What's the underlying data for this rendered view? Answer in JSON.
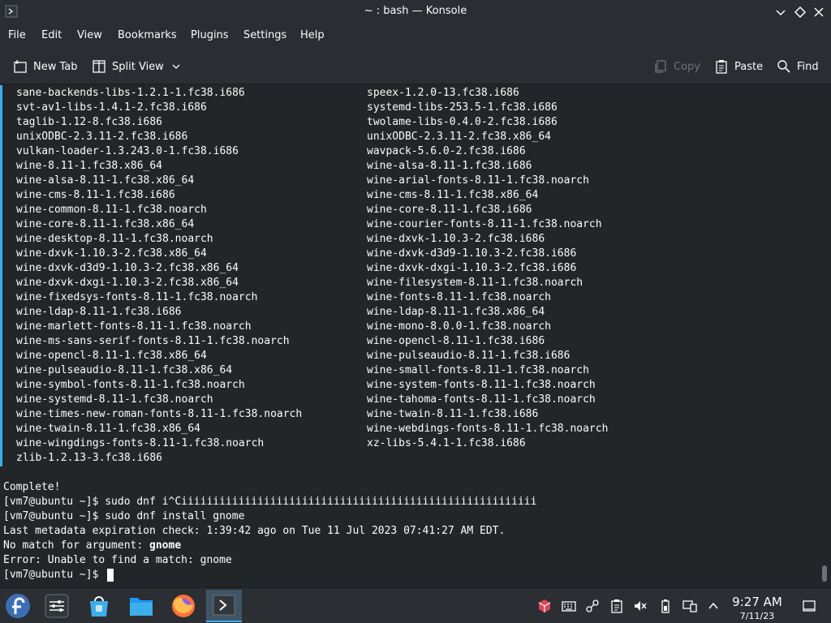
{
  "window": {
    "title": "~ : bash — Konsole"
  },
  "menu": [
    "File",
    "Edit",
    "View",
    "Bookmarks",
    "Plugins",
    "Settings",
    "Help"
  ],
  "toolbar": {
    "new_tab": "New Tab",
    "split_view": "Split View",
    "copy": "Copy",
    "paste": "Paste",
    "find": "Find"
  },
  "terminal": {
    "columns": [
      [
        "sane-backends-libs-1.2.1-1.fc38.i686",
        "speex-1.2.0-13.fc38.i686"
      ],
      [
        "svt-av1-libs-1.4.1-2.fc38.i686",
        "systemd-libs-253.5-1.fc38.i686"
      ],
      [
        "taglib-1.12-8.fc38.i686",
        "twolame-libs-0.4.0-2.fc38.i686"
      ],
      [
        "unixODBC-2.3.11-2.fc38.i686",
        "unixODBC-2.3.11-2.fc38.x86_64"
      ],
      [
        "vulkan-loader-1.3.243.0-1.fc38.i686",
        "wavpack-5.6.0-2.fc38.i686"
      ],
      [
        "wine-8.11-1.fc38.x86_64",
        "wine-alsa-8.11-1.fc38.i686"
      ],
      [
        "wine-alsa-8.11-1.fc38.x86_64",
        "wine-arial-fonts-8.11-1.fc38.noarch"
      ],
      [
        "wine-cms-8.11-1.fc38.i686",
        "wine-cms-8.11-1.fc38.x86_64"
      ],
      [
        "wine-common-8.11-1.fc38.noarch",
        "wine-core-8.11-1.fc38.i686"
      ],
      [
        "wine-core-8.11-1.fc38.x86_64",
        "wine-courier-fonts-8.11-1.fc38.noarch"
      ],
      [
        "wine-desktop-8.11-1.fc38.noarch",
        "wine-dxvk-1.10.3-2.fc38.i686"
      ],
      [
        "wine-dxvk-1.10.3-2.fc38.x86_64",
        "wine-dxvk-d3d9-1.10.3-2.fc38.i686"
      ],
      [
        "wine-dxvk-d3d9-1.10.3-2.fc38.x86_64",
        "wine-dxvk-dxgi-1.10.3-2.fc38.i686"
      ],
      [
        "wine-dxvk-dxgi-1.10.3-2.fc38.x86_64",
        "wine-filesystem-8.11-1.fc38.noarch"
      ],
      [
        "wine-fixedsys-fonts-8.11-1.fc38.noarch",
        "wine-fonts-8.11-1.fc38.noarch"
      ],
      [
        "wine-ldap-8.11-1.fc38.i686",
        "wine-ldap-8.11-1.fc38.x86_64"
      ],
      [
        "wine-marlett-fonts-8.11-1.fc38.noarch",
        "wine-mono-8.0.0-1.fc38.noarch"
      ],
      [
        "wine-ms-sans-serif-fonts-8.11-1.fc38.noarch",
        "wine-opencl-8.11-1.fc38.i686"
      ],
      [
        "wine-opencl-8.11-1.fc38.x86_64",
        "wine-pulseaudio-8.11-1.fc38.i686"
      ],
      [
        "wine-pulseaudio-8.11-1.fc38.x86_64",
        "wine-small-fonts-8.11-1.fc38.noarch"
      ],
      [
        "wine-symbol-fonts-8.11-1.fc38.noarch",
        "wine-system-fonts-8.11-1.fc38.noarch"
      ],
      [
        "wine-systemd-8.11-1.fc38.noarch",
        "wine-tahoma-fonts-8.11-1.fc38.noarch"
      ],
      [
        "wine-times-new-roman-fonts-8.11-1.fc38.noarch",
        "wine-twain-8.11-1.fc38.i686"
      ],
      [
        "wine-twain-8.11-1.fc38.x86_64",
        "wine-webdings-fonts-8.11-1.fc38.noarch"
      ],
      [
        "wine-wingdings-fonts-8.11-1.fc38.noarch",
        "xz-libs-5.4.1-1.fc38.i686"
      ],
      [
        "zlib-1.2.13-3.fc38.i686",
        ""
      ]
    ],
    "complete": "Complete!",
    "cmd1": "[vm7@ubuntu ~]$ sudo dnf i^Ciiiiiiiiiiiiiiiiiiiiiiiiiiiiiiiiiiiiiiiiiiiiiiiiiiiiiiii",
    "cmd2": "[vm7@ubuntu ~]$ sudo dnf install gnome",
    "metadata": "Last metadata expiration check: 1:39:42 ago on Tue 11 Jul 2023 07:41:27 AM EDT.",
    "nomatch_prefix": "No match for argument: ",
    "nomatch_arg": "gnome",
    "error": "Error: Unable to find a match: gnome",
    "prompt": "[vm7@ubuntu ~]$ "
  },
  "taskbar": {
    "apps": [
      "fedora-launcher-icon",
      "system-settings-icon",
      "discover-store-icon",
      "file-manager-icon",
      "firefox-icon",
      "konsole-icon"
    ],
    "time": "9:27 AM",
    "date": "7/11/23"
  },
  "colors": {
    "accent": "#3daee9",
    "background": "#232629",
    "chrome": "#2a2e32",
    "text": "#fcfcfc"
  }
}
